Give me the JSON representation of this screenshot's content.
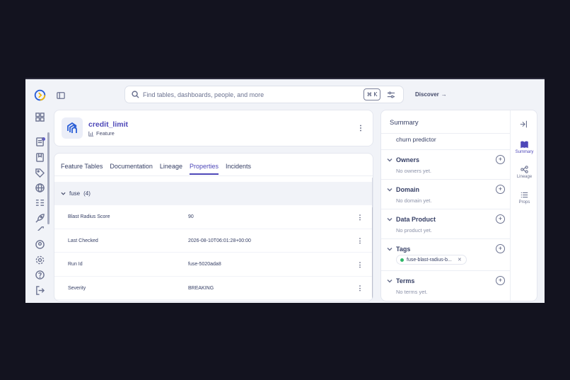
{
  "search": {
    "placeholder": "Find tables, dashboards, people, and more",
    "shortcut": "⌘ K"
  },
  "header": {
    "discover_label": "Discover",
    "discover_arrow": "→"
  },
  "entity": {
    "name": "credit_limit",
    "type": "Feature"
  },
  "tabs": [
    {
      "label": "Feature Tables",
      "active": false
    },
    {
      "label": "Documentation",
      "active": false
    },
    {
      "label": "Lineage",
      "active": false
    },
    {
      "label": "Properties",
      "active": true
    },
    {
      "label": "Incidents",
      "active": false
    }
  ],
  "properties": {
    "group_label": "fuse",
    "group_count": "(4)",
    "rows": [
      {
        "name": "Blast Radius Score",
        "value": "90"
      },
      {
        "name": "Last Checked",
        "value": "2026-08-10T06:01:28+00:00"
      },
      {
        "name": "Run Id",
        "value": "fuse-5020ada8"
      },
      {
        "name": "Severity",
        "value": "BREAKING"
      }
    ]
  },
  "summary": {
    "title": "Summary",
    "clipped_text": "(partial text cut off at top)",
    "description_tail": "churn predictor",
    "sections": {
      "owners": {
        "label": "Owners",
        "empty": "No owners yet."
      },
      "domain": {
        "label": "Domain",
        "empty": "No domain yet."
      },
      "data_product": {
        "label": "Data Product",
        "empty": "No product yet."
      },
      "tags": {
        "label": "Tags",
        "tag": "fuse-blast-radius-b...",
        "tag_color": "#2fb768"
      },
      "terms": {
        "label": "Terms",
        "empty": "No terms yet."
      }
    }
  },
  "right_rail": [
    {
      "label": "Summary",
      "icon": "book-icon",
      "active": true
    },
    {
      "label": "Lineage",
      "icon": "lineage-icon",
      "active": false
    },
    {
      "label": "Props",
      "icon": "list-icon",
      "active": false
    }
  ],
  "colors": {
    "accent": "#4d47b8",
    "tag_dot": "#2fb768"
  }
}
